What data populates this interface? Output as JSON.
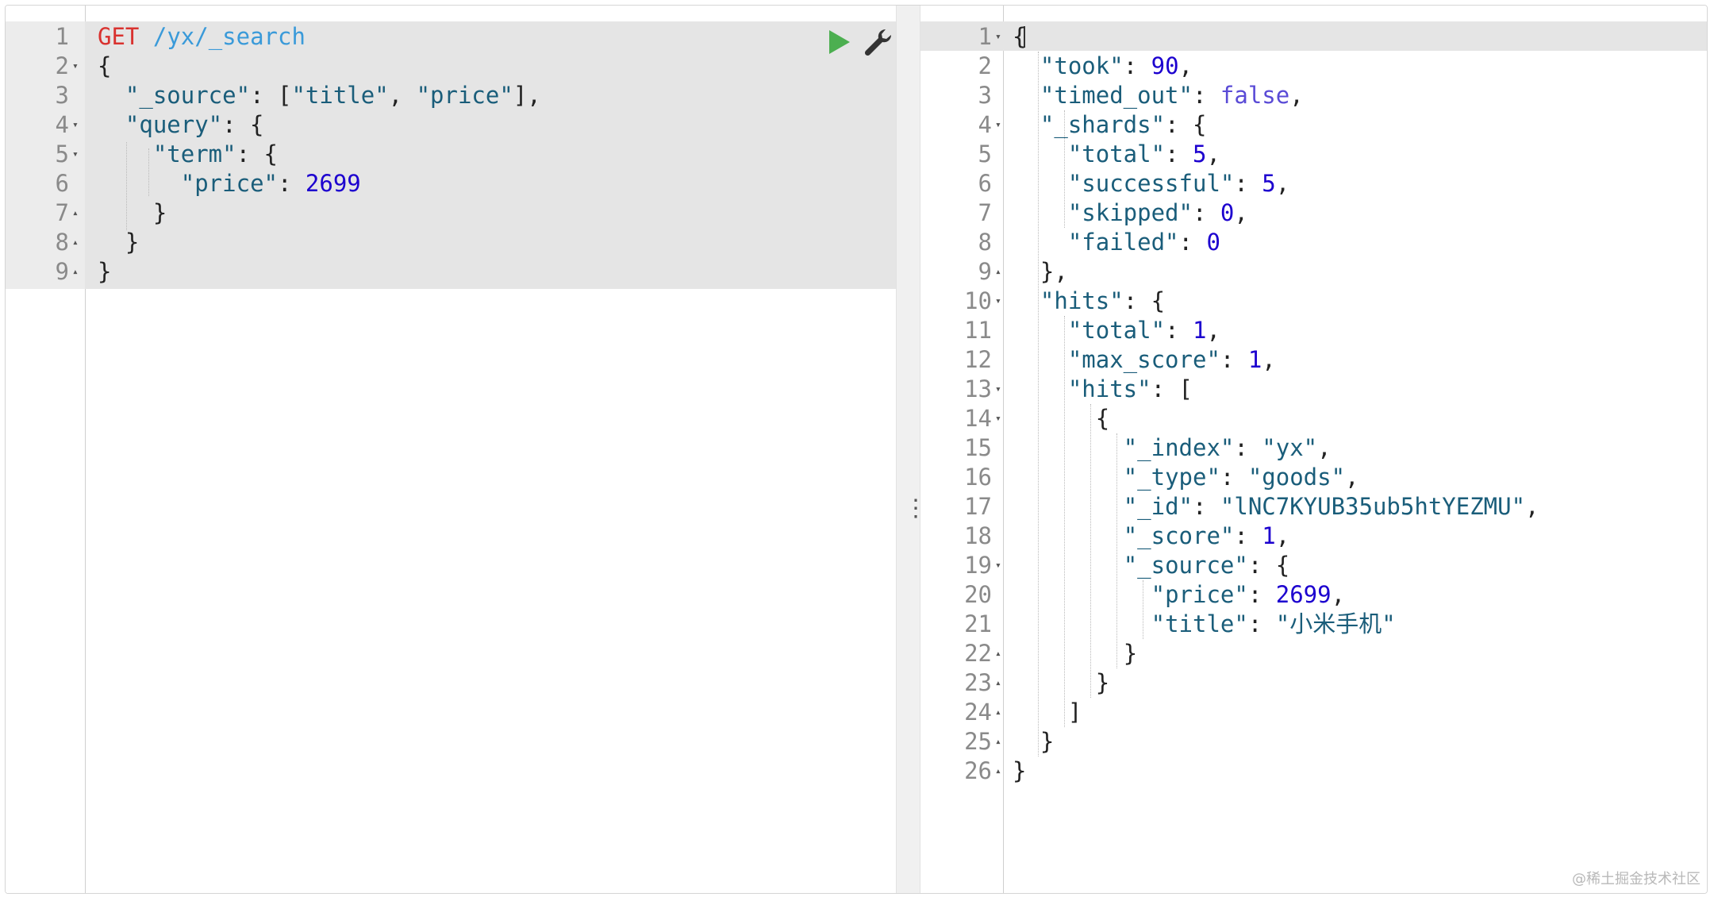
{
  "request": {
    "method": "GET",
    "url": "/yx/_search",
    "lines": [
      {
        "n": "1",
        "fold": ""
      },
      {
        "n": "2",
        "fold": "▾"
      },
      {
        "n": "3",
        "fold": ""
      },
      {
        "n": "4",
        "fold": "▾"
      },
      {
        "n": "5",
        "fold": "▾"
      },
      {
        "n": "6",
        "fold": ""
      },
      {
        "n": "7",
        "fold": "▴"
      },
      {
        "n": "8",
        "fold": "▴"
      },
      {
        "n": "9",
        "fold": "▴"
      }
    ],
    "tokens": {
      "l2": "{",
      "l3_key": "\"_source\"",
      "l3_rest": ": [",
      "l3_v1": "\"title\"",
      "l3_sep": ", ",
      "l3_v2": "\"price\"",
      "l3_end": "],",
      "l4_key": "\"query\"",
      "l4_rest": ": {",
      "l5_key": "\"term\"",
      "l5_rest": ": {",
      "l6_key": "\"price\"",
      "l6_colon": ": ",
      "l6_val": "2699",
      "l7": "}",
      "l8": "}",
      "l9": "}"
    }
  },
  "response": {
    "lines": [
      {
        "n": "1",
        "fold": "▾"
      },
      {
        "n": "2",
        "fold": ""
      },
      {
        "n": "3",
        "fold": ""
      },
      {
        "n": "4",
        "fold": "▾"
      },
      {
        "n": "5",
        "fold": ""
      },
      {
        "n": "6",
        "fold": ""
      },
      {
        "n": "7",
        "fold": ""
      },
      {
        "n": "8",
        "fold": ""
      },
      {
        "n": "9",
        "fold": "▴"
      },
      {
        "n": "10",
        "fold": "▾"
      },
      {
        "n": "11",
        "fold": ""
      },
      {
        "n": "12",
        "fold": ""
      },
      {
        "n": "13",
        "fold": "▾"
      },
      {
        "n": "14",
        "fold": "▾"
      },
      {
        "n": "15",
        "fold": ""
      },
      {
        "n": "16",
        "fold": ""
      },
      {
        "n": "17",
        "fold": ""
      },
      {
        "n": "18",
        "fold": ""
      },
      {
        "n": "19",
        "fold": "▾"
      },
      {
        "n": "20",
        "fold": ""
      },
      {
        "n": "21",
        "fold": ""
      },
      {
        "n": "22",
        "fold": "▴"
      },
      {
        "n": "23",
        "fold": "▴"
      },
      {
        "n": "24",
        "fold": "▴"
      },
      {
        "n": "25",
        "fold": "▴"
      },
      {
        "n": "26",
        "fold": "▴"
      }
    ],
    "tokens": {
      "open": "{",
      "took_k": "\"took\"",
      "took_v": "90",
      "timed_k": "\"timed_out\"",
      "timed_v": "false",
      "shards_k": "\"_shards\"",
      "total_k": "\"total\"",
      "total_v": "5",
      "succ_k": "\"successful\"",
      "succ_v": "5",
      "skip_k": "\"skipped\"",
      "skip_v": "0",
      "fail_k": "\"failed\"",
      "fail_v": "0",
      "shards_close": "},",
      "hits_k": "\"hits\"",
      "htotal_k": "\"total\"",
      "htotal_v": "1",
      "max_k": "\"max_score\"",
      "max_v": "1",
      "hits2_k": "\"hits\"",
      "bracket_open": "[",
      "obj_open": "{",
      "index_k": "\"_index\"",
      "index_v": "\"yx\"",
      "type_k": "\"_type\"",
      "type_v": "\"goods\"",
      "id_k": "\"_id\"",
      "id_v": "\"lNC7KYUB35ub5htYEZMU\"",
      "score_k": "\"_score\"",
      "score_v": "1",
      "src_k": "\"_source\"",
      "price_k": "\"price\"",
      "price_v": "2699",
      "title_k": "\"title\"",
      "title_v": "\"小米手机\"",
      "src_close": "}",
      "obj_close": "}",
      "bracket_close": "]",
      "hits_close": "}",
      "close": "}"
    }
  },
  "splitter": {
    "handle": "⋮"
  },
  "icons": {
    "play": "play-icon",
    "wrench": "wrench-icon"
  },
  "colors": {
    "play_green": "#4caf50",
    "selection": "#e5e5e5"
  },
  "watermark": "@稀土掘金技术社区"
}
